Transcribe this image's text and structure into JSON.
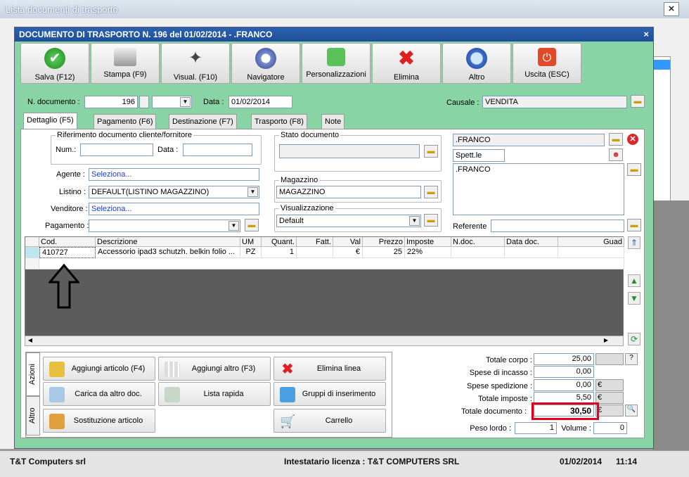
{
  "bg_window": {
    "title": "Lista documenti di trasporto"
  },
  "dialog": {
    "title": "DOCUMENTO DI TRASPORTO N. 196 del 01/02/2014 - .FRANCO"
  },
  "toolbar": [
    {
      "label": "Salva (F12)",
      "icon": "check-icon"
    },
    {
      "label": "Stampa (F9)",
      "icon": "printer-icon"
    },
    {
      "label": "Visual. (F10)",
      "icon": "magic-wand-icon"
    },
    {
      "label": "Navigatore",
      "icon": "compass-icon"
    },
    {
      "label": "Personalizzazioni",
      "icon": "puzzle-icon"
    },
    {
      "label": "Elimina",
      "icon": "delete-x-icon"
    },
    {
      "label": "Altro",
      "icon": "magnifier-icon"
    },
    {
      "label": "Uscita (ESC)",
      "icon": "power-icon"
    }
  ],
  "header": {
    "n_documento_label": "N. documento :",
    "n_documento_value": "196",
    "data_label": "Data :",
    "data_value": "01/02/2014",
    "causale_label": "Causale :",
    "causale_value": "VENDITA"
  },
  "tabs": [
    "Dettaglio (F5)",
    "Pagamento (F6)",
    "Destinazione (F7)",
    "Trasporto (F8)",
    "Note"
  ],
  "riferimento": {
    "title": "Riferimento documento cliente/fornitore",
    "num_label": "Num.:",
    "data_label": "Data :"
  },
  "fields": {
    "agente_label": "Agente :",
    "agente_value": "Seleziona...",
    "listino_label": "Listino :",
    "listino_value": "DEFAULT(LISTINO MAGAZZINO)",
    "venditore_label": "Venditore :",
    "venditore_value": "Seleziona...",
    "pagamento_label": "Pagamento :"
  },
  "stato": {
    "title": "Stato documento"
  },
  "magazzino": {
    "title": "Magazzino",
    "value": "MAGAZZINO"
  },
  "visualizzazione": {
    "title": "Visualizzazione",
    "value": "Default"
  },
  "cliente": {
    "name": ".FRANCO",
    "salutation": "Spett.le",
    "address": ".FRANCO",
    "referente_label": "Referente"
  },
  "grid": {
    "columns": [
      "Cod.",
      "Descrizione",
      "UM",
      "Quant.",
      "Fatt.",
      "Val",
      "Prezzo",
      "Imposte",
      "N.doc.",
      "Data doc.",
      "Guad"
    ],
    "rows": [
      {
        "cod": "410727",
        "descrizione": "Accessorio ipad3 schutzh. belkin folio ...",
        "um": "PZ",
        "quant": "1",
        "fatt": "",
        "val": "€",
        "prezzo": "25",
        "imposte": "22%",
        "ndoc": "",
        "datadoc": "",
        "guad": ""
      }
    ]
  },
  "side_tabs": {
    "azioni": "Azioni",
    "altro": "Altro"
  },
  "actions": [
    {
      "label": "Aggiungi articolo (F4)",
      "icon": "add-article-icon"
    },
    {
      "label": "Aggiungi altro (F3)",
      "icon": "add-grid-icon"
    },
    {
      "label": "Elimina linea",
      "icon": "delete-line-icon"
    },
    {
      "label": "Carica da altro doc.",
      "icon": "load-doc-icon"
    },
    {
      "label": "Lista rapida",
      "icon": "quick-list-icon"
    },
    {
      "label": "Gruppi di inserimento",
      "icon": "groups-icon"
    },
    {
      "label": "Sostituzione articolo",
      "icon": "replace-icon"
    },
    {
      "label": "Carrello",
      "icon": "cart-icon"
    }
  ],
  "totals": {
    "totale_corpo_label": "Totale corpo :",
    "totale_corpo": "25,00",
    "spese_incasso_label": "Spese di incasso :",
    "spese_incasso": "0,00",
    "spese_spedizione_label": "Spese spedizione :",
    "spese_spedizione": "0,00",
    "totale_imposte_label": "Totale imposte :",
    "totale_imposte": "5,50",
    "totale_documento_label": "Totale documento :",
    "totale_documento": "30,50",
    "peso_lordo_label": "Peso lordo :",
    "peso_lordo": "1",
    "volume_label": "Volume :",
    "volume": "0",
    "currency": "€",
    "help": "?"
  },
  "statusbar": {
    "company": "T&T Computers srl",
    "license": "Intestatario licenza : T&T COMPUTERS SRL",
    "date": "01/02/2014",
    "time": "11:14"
  },
  "colors": {
    "dialog_bg": "#89d4a4",
    "title_blue": "#1e4e98",
    "highlight_red": "#e00020"
  }
}
